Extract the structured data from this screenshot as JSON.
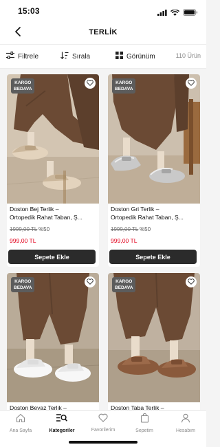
{
  "status_bar": {
    "time": "15:03"
  },
  "header": {
    "title": "TERLİK",
    "back_icon": "chevron-left-icon"
  },
  "toolbar": {
    "filter_label": "Filtrele",
    "sort_label": "Sırala",
    "view_label": "Görünüm",
    "count_label": "110 Ürün"
  },
  "products": [
    {
      "badge_line1": "KARGO",
      "badge_line2": "BEDAVA",
      "name_line1": "Doston Bej Terlik –",
      "name_line2": "Ortopedik Rahat Taban, Ş...",
      "old_price": "1999,00 TL",
      "discount": "%50",
      "price": "999,00 TL",
      "button": "Sepete Ekle",
      "shoe_color": "#e3d3bd"
    },
    {
      "badge_line1": "KARGO",
      "badge_line2": "BEDAVA",
      "name_line1": "Doston Gri Terlik –",
      "name_line2": "Ortopedik Rahat Taban, Ş...",
      "old_price": "1999,00 TL",
      "discount": "%50",
      "price": "999,00 TL",
      "button": "Sepete Ekle",
      "shoe_color": "#c9c9c9"
    },
    {
      "badge_line1": "KARGO",
      "badge_line2": "BEDAVA",
      "name_line1": "Doston Beyaz Terlik –",
      "shoe_color": "#f7f7f7"
    },
    {
      "badge_line1": "KARGO",
      "badge_line2": "BEDAVA",
      "name_line1": "Doston Taba Terlik –",
      "shoe_color": "#8a5a3c"
    }
  ],
  "tabbar": {
    "items": [
      {
        "label": "Ana Sayfa",
        "icon": "home-icon"
      },
      {
        "label": "Kategoriler",
        "icon": "category-search-icon"
      },
      {
        "label": "Favorilerim",
        "icon": "heart-icon"
      },
      {
        "label": "Sepetim",
        "icon": "cart-bag-icon"
      },
      {
        "label": "Hesabım",
        "icon": "user-icon"
      }
    ],
    "active_index": 1
  },
  "colors": {
    "price_red": "#e3001b",
    "button_dark": "#2b2b2b",
    "badge_grey": "#5c5c5c",
    "trouser_brown": "#6b4a34",
    "floor_beige": "#c7b7a2"
  }
}
